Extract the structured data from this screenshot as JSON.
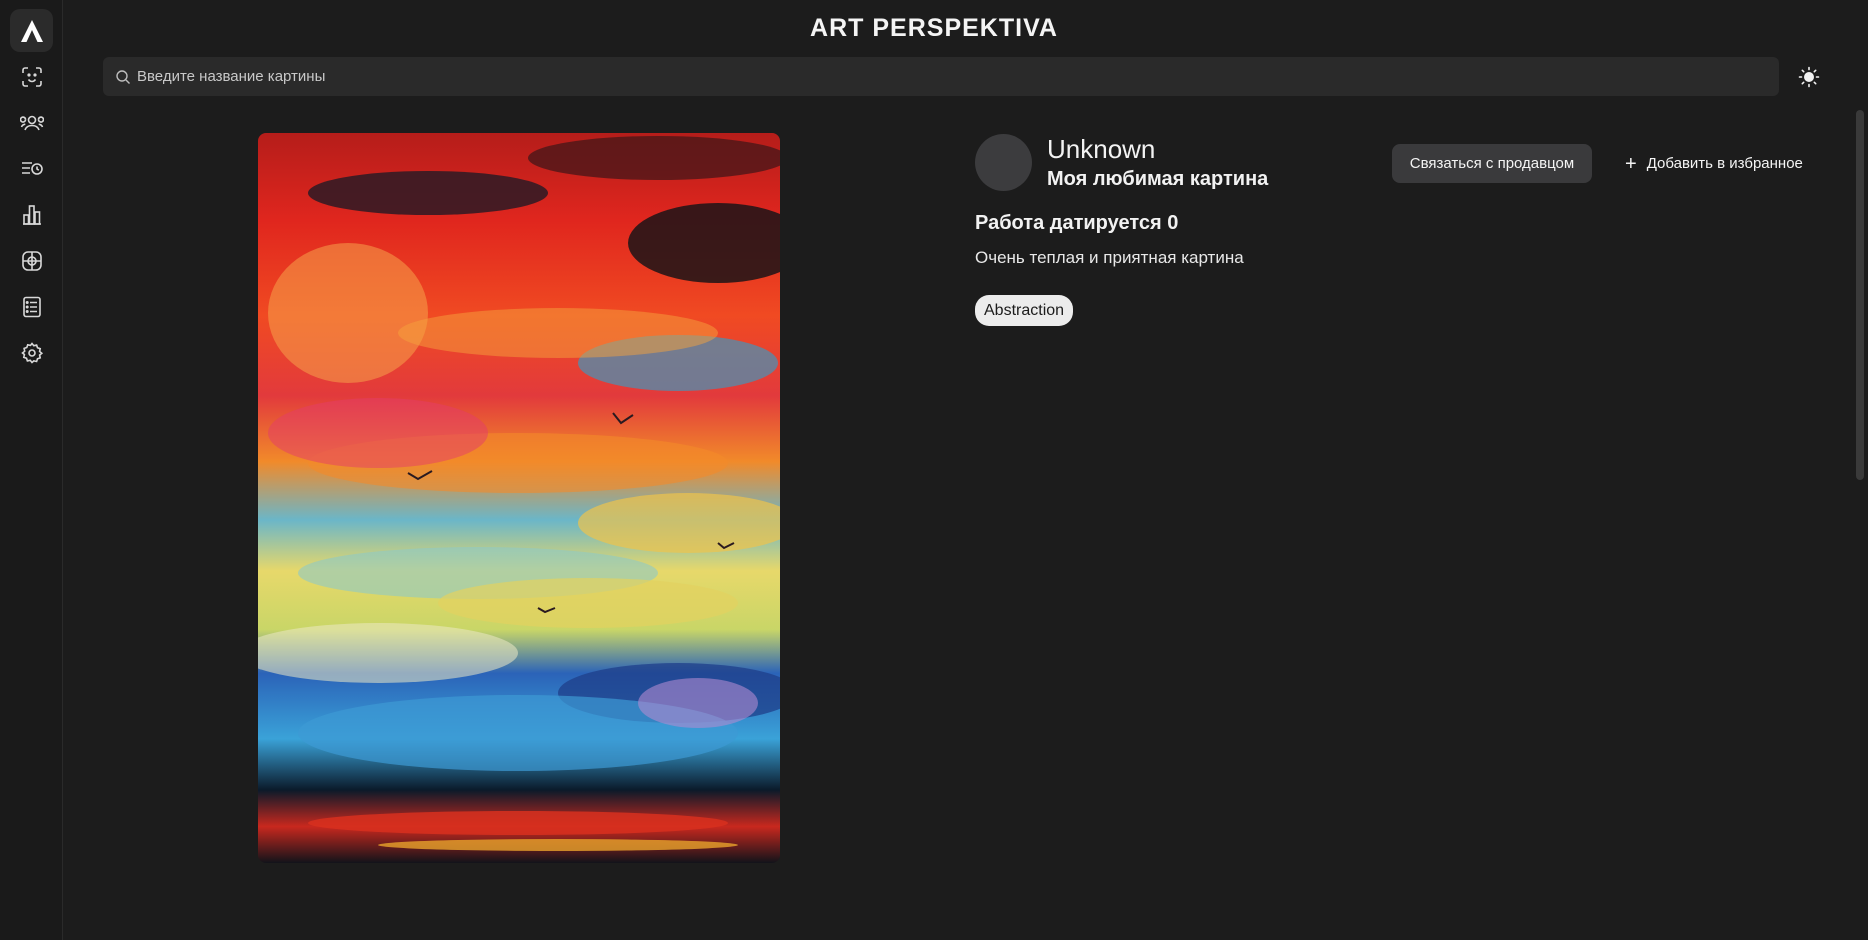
{
  "header": {
    "title": "ART PERSPEKTIVA"
  },
  "logo": {
    "letter": "A"
  },
  "search": {
    "placeholder": "Введите название картины",
    "value": ""
  },
  "sidebar": {
    "items": [
      {
        "name": "face-scan-icon"
      },
      {
        "name": "people-icon"
      },
      {
        "name": "list-clock-icon"
      },
      {
        "name": "bar-chart-icon"
      },
      {
        "name": "gallery-icon"
      },
      {
        "name": "document-list-icon"
      },
      {
        "name": "gear-icon"
      }
    ]
  },
  "theme_toggle": {
    "icon": "sun-icon"
  },
  "artwork": {
    "author": "Unknown",
    "title": "Моя любимая картина",
    "dated": "Работа датируется 0",
    "description": "Очень теплая и приятная картина",
    "tag": "Abstraction",
    "contact_label": "Связаться с продавцом",
    "favorite_label": "Добавить в избранное",
    "favorite_icon": "+"
  },
  "colors": {
    "background": "#1c1c1c",
    "search_bg": "#2a2a2a",
    "button_bg": "#3a3a3c",
    "avatar_bg": "#3c3c3e"
  }
}
